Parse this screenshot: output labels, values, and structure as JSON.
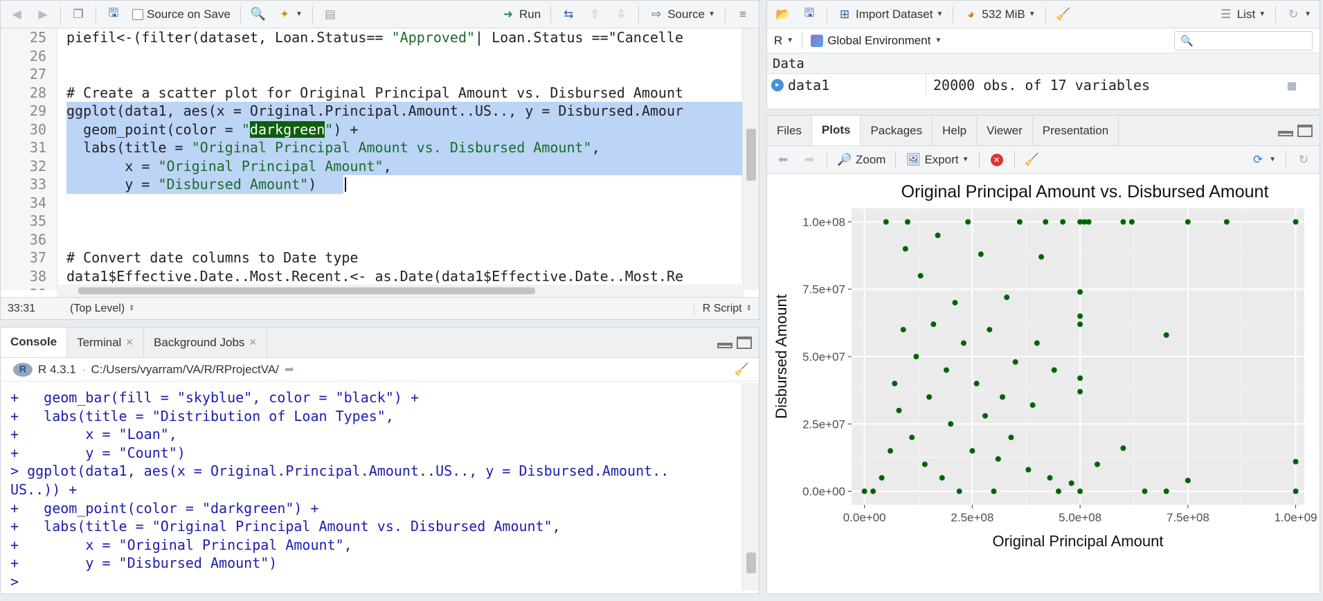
{
  "editor": {
    "toolbar": {
      "source_on_save": "Source on Save",
      "run": "Run",
      "source": "Source"
    },
    "lines": [
      {
        "n": "25",
        "t": "piefil<-(filter(dataset, Loan.Status== \"Approved\"| Loan.Status ==\"Cancelle"
      },
      {
        "n": "26",
        "t": ""
      },
      {
        "n": "27",
        "t": ""
      },
      {
        "n": "28",
        "t": "# Create a scatter plot for Original Principal Amount vs. Disbursed Amount"
      },
      {
        "n": "29",
        "t": "ggplot(data1, aes(x = Original.Principal.Amount..US.., y = Disbursed.Amour"
      },
      {
        "n": "30",
        "t": "  geom_point(color = \"darkgreen\") +"
      },
      {
        "n": "31",
        "t": "  labs(title = \"Original Principal Amount vs. Disbursed Amount\","
      },
      {
        "n": "32",
        "t": "       x = \"Original Principal Amount\","
      },
      {
        "n": "33",
        "t": "       y = \"Disbursed Amount\")"
      },
      {
        "n": "34",
        "t": ""
      },
      {
        "n": "35",
        "t": ""
      },
      {
        "n": "36",
        "t": ""
      },
      {
        "n": "37",
        "t": "# Convert date columns to Date type"
      },
      {
        "n": "38",
        "t": "data1$Effective.Date..Most.Recent.<- as.Date(data1$Effective.Date..Most.Re"
      },
      {
        "n": "39",
        "t": ""
      }
    ],
    "status": {
      "position": "33:31",
      "scope": "(Top Level)",
      "file_type": "R Script"
    }
  },
  "console": {
    "tabs": [
      "Console",
      "Terminal",
      "Background Jobs"
    ],
    "r_version": "R 4.3.1",
    "path": "C:/Users/vyarram/VA/R/RProjectVA/",
    "lines": [
      "+   geom_bar(fill = \"skyblue\", color = \"black\") +",
      "+   labs(title = \"Distribution of Loan Types\",",
      "+        x = \"Loan\",",
      "+        y = \"Count\")",
      "> ggplot(data1, aes(x = Original.Principal.Amount..US.., y = Disbursed.Amount..",
      "US..)) +",
      "+   geom_point(color = \"darkgreen\") +",
      "+   labs(title = \"Original Principal Amount vs. Disbursed Amount\",",
      "+        x = \"Original Principal Amount\",",
      "+        y = \"Disbursed Amount\")",
      "> "
    ]
  },
  "environment": {
    "import_dataset": "Import Dataset",
    "memory": "532 MiB",
    "view_mode": "List",
    "language": "R",
    "scope": "Global Environment",
    "section": "Data",
    "rows": [
      {
        "name": "data1",
        "value": "20000 obs. of 17 variables"
      }
    ]
  },
  "plots_pane": {
    "tabs": [
      "Files",
      "Plots",
      "Packages",
      "Help",
      "Viewer",
      "Presentation"
    ],
    "active_tab": "Plots",
    "zoom": "Zoom",
    "export": "Export"
  },
  "chart_data": {
    "type": "scatter",
    "title": "Original Principal Amount vs. Disbursed Amount",
    "xlabel": "Original Principal Amount",
    "ylabel": "Disbursed Amount",
    "xlim": [
      -30000000,
      1020000000
    ],
    "ylim": [
      -5000000,
      105000000
    ],
    "xticks": [
      {
        "v": 0,
        "label": "0.0e+00"
      },
      {
        "v": 250000000,
        "label": "2.5e+08"
      },
      {
        "v": 500000000,
        "label": "5.0e+08"
      },
      {
        "v": 750000000,
        "label": "7.5e+08"
      },
      {
        "v": 1000000000,
        "label": "1.0e+09"
      }
    ],
    "yticks": [
      {
        "v": 0,
        "label": "0.0e+00"
      },
      {
        "v": 25000000,
        "label": "2.5e+07"
      },
      {
        "v": 50000000,
        "label": "5.0e+07"
      },
      {
        "v": 75000000,
        "label": "7.5e+07"
      },
      {
        "v": 100000000,
        "label": "1.0e+08"
      }
    ],
    "point_color": "#006400",
    "panel_color": "#ebebeb",
    "grid": true,
    "series": [
      {
        "values": [
          [
            0,
            0
          ],
          [
            20000000,
            0
          ],
          [
            40000000,
            5000000
          ],
          [
            60000000,
            15000000
          ],
          [
            80000000,
            30000000
          ],
          [
            90000000,
            60000000
          ],
          [
            95000000,
            90000000
          ],
          [
            100000000,
            100000000
          ],
          [
            50000000,
            100000000
          ],
          [
            70000000,
            40000000
          ],
          [
            110000000,
            20000000
          ],
          [
            120000000,
            50000000
          ],
          [
            130000000,
            80000000
          ],
          [
            140000000,
            10000000
          ],
          [
            150000000,
            35000000
          ],
          [
            160000000,
            62000000
          ],
          [
            170000000,
            95000000
          ],
          [
            180000000,
            5000000
          ],
          [
            190000000,
            45000000
          ],
          [
            200000000,
            25000000
          ],
          [
            210000000,
            70000000
          ],
          [
            220000000,
            0
          ],
          [
            230000000,
            55000000
          ],
          [
            240000000,
            100000000
          ],
          [
            250000000,
            15000000
          ],
          [
            260000000,
            40000000
          ],
          [
            270000000,
            88000000
          ],
          [
            280000000,
            28000000
          ],
          [
            290000000,
            60000000
          ],
          [
            300000000,
            0
          ],
          [
            310000000,
            12000000
          ],
          [
            320000000,
            35000000
          ],
          [
            330000000,
            72000000
          ],
          [
            340000000,
            20000000
          ],
          [
            350000000,
            48000000
          ],
          [
            360000000,
            100000000
          ],
          [
            380000000,
            8000000
          ],
          [
            390000000,
            32000000
          ],
          [
            400000000,
            55000000
          ],
          [
            410000000,
            87000000
          ],
          [
            420000000,
            100000000
          ],
          [
            430000000,
            5000000
          ],
          [
            440000000,
            45000000
          ],
          [
            450000000,
            0
          ],
          [
            460000000,
            100000000
          ],
          [
            480000000,
            3000000
          ],
          [
            500000000,
            100000000
          ],
          [
            500000000,
            74000000
          ],
          [
            500000000,
            65000000
          ],
          [
            500000000,
            62000000
          ],
          [
            500000000,
            42000000
          ],
          [
            500000000,
            37000000
          ],
          [
            500000000,
            0
          ],
          [
            510000000,
            100000000
          ],
          [
            520000000,
            100000000
          ],
          [
            540000000,
            10000000
          ],
          [
            600000000,
            16000000
          ],
          [
            600000000,
            100000000
          ],
          [
            620000000,
            100000000
          ],
          [
            650000000,
            0
          ],
          [
            700000000,
            58000000
          ],
          [
            700000000,
            0
          ],
          [
            750000000,
            100000000
          ],
          [
            750000000,
            4000000
          ],
          [
            840000000,
            100000000
          ],
          [
            1000000000,
            100000000
          ],
          [
            1000000000,
            11000000
          ],
          [
            1000000000,
            0
          ]
        ]
      }
    ]
  }
}
